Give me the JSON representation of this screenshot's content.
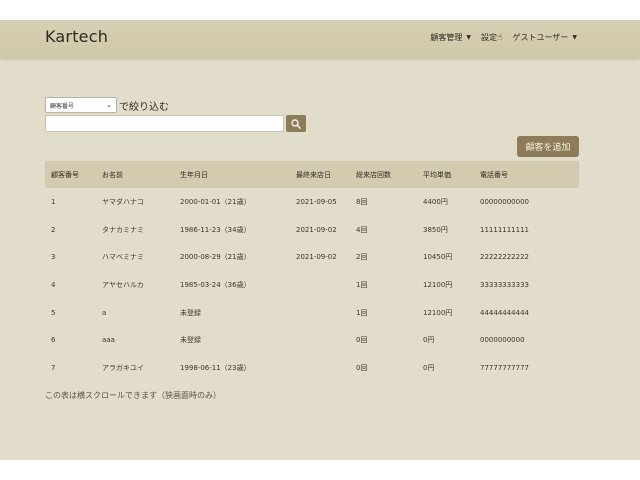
{
  "app": {
    "brand": "Kartech"
  },
  "nav": {
    "customer_mgmt": "顧客管理",
    "settings": "設定",
    "guest_user": "ゲストユーザー"
  },
  "filter": {
    "select_value": "顧客番号",
    "suffix": "で絞り込む"
  },
  "search": {
    "value": "",
    "placeholder": ""
  },
  "add_button": "顧客を追加",
  "table": {
    "headers": [
      "顧客番号",
      "お名前",
      "生年月日",
      "最終来店日",
      "総来店回数",
      "平均単価",
      "電話番号"
    ],
    "rows": [
      [
        "1",
        "ヤマダハナコ",
        "2000-01-01（21歳）",
        "2021-09-05",
        "8回",
        "4400円",
        "00000000000"
      ],
      [
        "2",
        "タナカミナミ",
        "1986-11-23（34歳）",
        "2021-09-02",
        "4回",
        "3850円",
        "11111111111"
      ],
      [
        "3",
        "ハマベミナミ",
        "2000-08-29（21歳）",
        "2021-09-02",
        "2回",
        "10450円",
        "22222222222"
      ],
      [
        "4",
        "アヤセハルカ",
        "1985-03-24（36歳）",
        "",
        "1回",
        "12100円",
        "33333333333"
      ],
      [
        "5",
        "a",
        "未登録",
        "",
        "1回",
        "12100円",
        "44444444444"
      ],
      [
        "6",
        "aaa",
        "未登録",
        "",
        "0回",
        "0円",
        "0000000000"
      ],
      [
        "7",
        "アラガキユイ",
        "1998-06-11（23歳）",
        "",
        "0回",
        "0円",
        "77777777777"
      ]
    ]
  },
  "note": "この表は横スクロールできます（狭画面時のみ）",
  "colors": {
    "background": "#e2ddcb",
    "navbar": "#d2cbaf",
    "accent": "#8c7c58"
  },
  "icons": {
    "search": "search-icon",
    "caret": "caret-down-icon",
    "cursor": "mouse-cursor-icon"
  }
}
